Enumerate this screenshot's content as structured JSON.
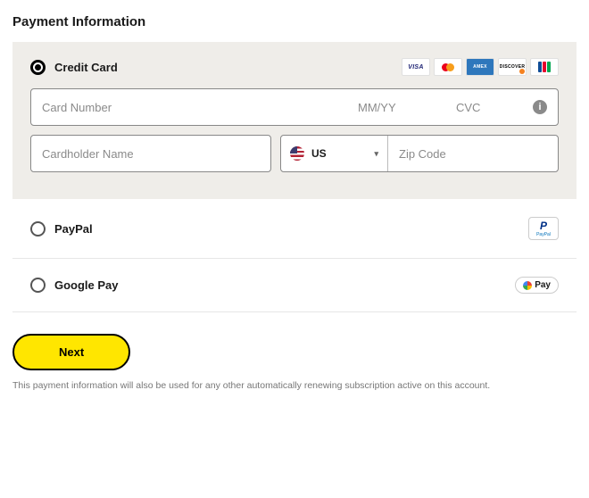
{
  "heading": "Payment Information",
  "options": {
    "credit_card": {
      "label": "Credit Card",
      "selected": true
    },
    "paypal": {
      "label": "PayPal",
      "selected": false
    },
    "google_pay": {
      "label": "Google Pay",
      "selected": false
    }
  },
  "card_brands": [
    "visa",
    "mastercard",
    "amex",
    "discover",
    "jcb"
  ],
  "card_form": {
    "card_number": {
      "value": "",
      "placeholder": "Card Number"
    },
    "expiry": {
      "value": "",
      "placeholder": "MM/YY"
    },
    "cvc": {
      "value": "",
      "placeholder": "CVC"
    },
    "cardholder": {
      "value": "",
      "placeholder": "Cardholder Name"
    },
    "country": {
      "code": "US"
    },
    "zip": {
      "value": "",
      "placeholder": "Zip Code"
    }
  },
  "buttons": {
    "next": "Next"
  },
  "gpay_label": "Pay",
  "disclaimer": "This payment information will also be used for any other automatically renewing subscription active on this account."
}
